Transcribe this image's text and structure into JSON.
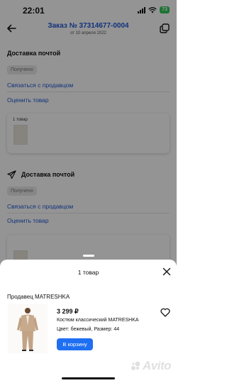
{
  "status_bar": {
    "time": "22:01",
    "battery": "73"
  },
  "header": {
    "title": "Заказ № 37314677-0004",
    "date": "от 10 апреля 2022"
  },
  "deliveries": [
    {
      "title": "Доставка почтой",
      "status": "Получено",
      "contact_link": "Связаться с продавцом",
      "rate_link": "Оценить товар",
      "items_count": "1 товар"
    },
    {
      "title": "Доставка почтой",
      "status": "Получено",
      "contact_link": "Связаться с продавцом",
      "rate_link": "Оценить товар"
    }
  ],
  "sheet": {
    "title": "1 товар",
    "seller": "Продавец MATRESHKA",
    "product": {
      "price": "3 299 ₽",
      "name": "Костюм классический MATRESHKA",
      "attributes": "Цвет: бежевый, Размер: 44",
      "cart_button": "В корзину"
    },
    "watermark": "Avito"
  },
  "colors": {
    "accent": "#1f57d6",
    "button": "#1f6ff2",
    "battery": "#34c759"
  }
}
